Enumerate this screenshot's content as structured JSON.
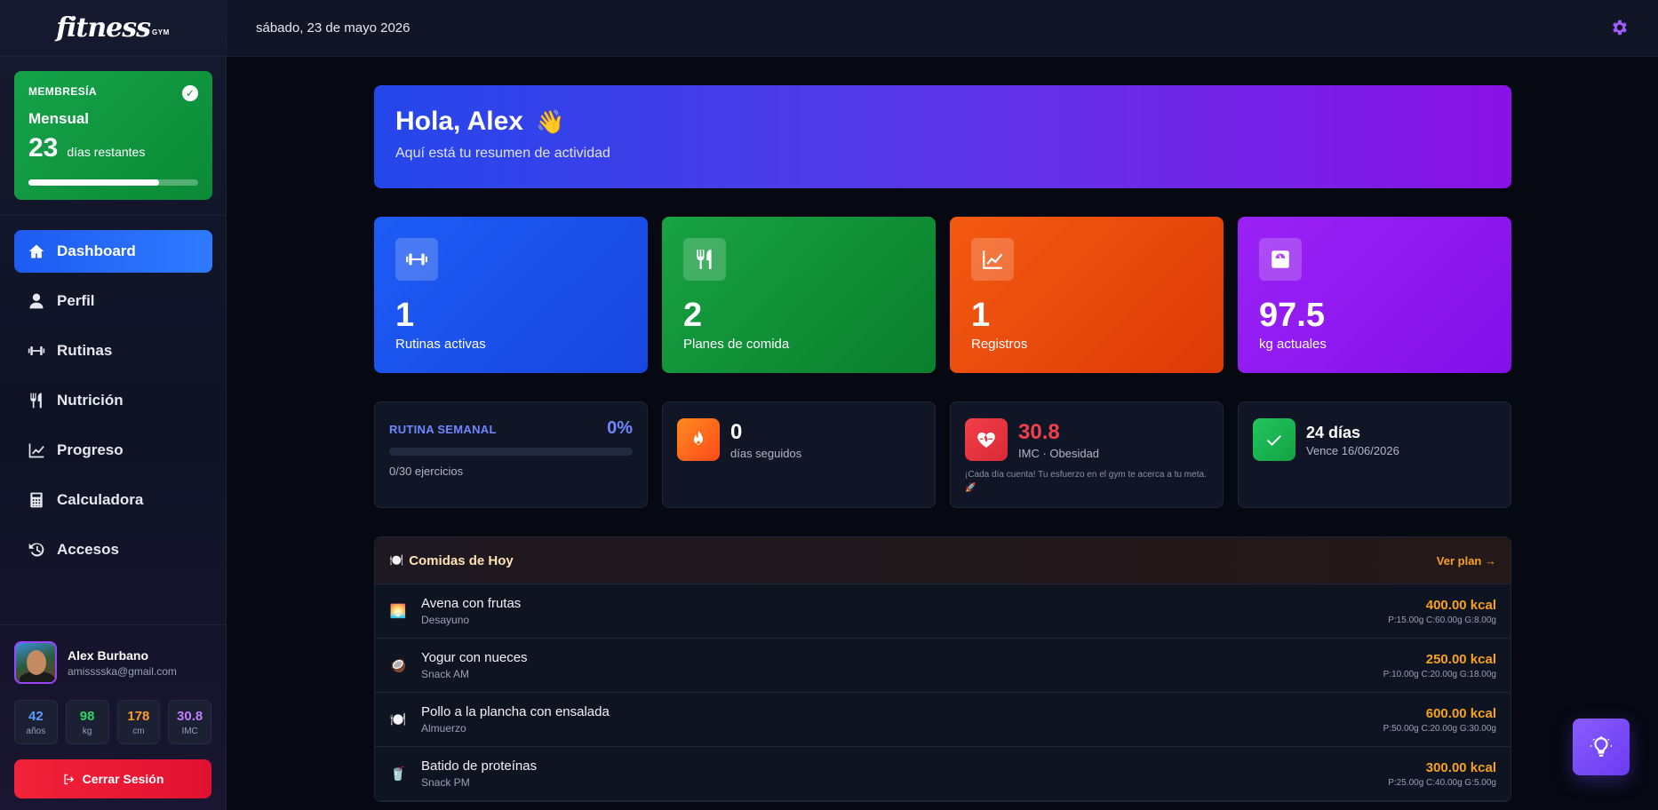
{
  "brand": {
    "logo_text": "fitness",
    "logo_sub": "GYM"
  },
  "header": {
    "date": "sábado, 23 de mayo 2026"
  },
  "membership": {
    "label": "MEMBRESÍA",
    "plan": "Mensual",
    "days": "23",
    "days_label": "días restantes",
    "progress_fraction": 0.77
  },
  "nav": {
    "items": [
      {
        "label": "Dashboard",
        "icon": "home-icon"
      },
      {
        "label": "Perfil",
        "icon": "user-icon"
      },
      {
        "label": "Rutinas",
        "icon": "dumbbell-icon"
      },
      {
        "label": "Nutrición",
        "icon": "utensils-icon"
      },
      {
        "label": "Progreso",
        "icon": "chart-line-icon"
      },
      {
        "label": "Calculadora",
        "icon": "calculator-icon"
      },
      {
        "label": "Accesos",
        "icon": "history-icon"
      }
    ],
    "active": "Dashboard"
  },
  "user": {
    "name": "Alex Burbano",
    "email": "amisssska@gmail.com",
    "stats": [
      {
        "value": "42",
        "label": "años",
        "color": "#5b9bff"
      },
      {
        "value": "98",
        "label": "kg",
        "color": "#2dd466"
      },
      {
        "value": "178",
        "label": "cm",
        "color": "#ff9a2a"
      },
      {
        "value": "30.8",
        "label": "IMC",
        "color": "#c27cff"
      }
    ],
    "logout_label": "Cerrar Sesión"
  },
  "hero": {
    "title": "Hola, Alex",
    "emoji": "👋",
    "subtitle": "Aquí está tu resumen de actividad"
  },
  "cards": [
    {
      "value": "1",
      "label": "Rutinas activas",
      "icon": "dumbbell-icon",
      "color": "#1d5cf5"
    },
    {
      "value": "2",
      "label": "Planes de comida",
      "icon": "utensils-icon",
      "color": "#18a343"
    },
    {
      "value": "1",
      "label": "Registros",
      "icon": "chart-line-icon",
      "color": "#f45a12"
    },
    {
      "value": "97.5",
      "label": "kg actuales",
      "icon": "scale-icon",
      "color": "#9a22f5"
    }
  ],
  "weekly": {
    "label": "RUTINA SEMANAL",
    "percent": "0%",
    "progress_fraction": 0,
    "sub": "0/30 ejercicios"
  },
  "streak": {
    "value": "0",
    "label": "días seguidos"
  },
  "bmi": {
    "value": "30.8",
    "label": "IMC · Obesidad",
    "note": "¡Cada día cuenta! Tu esfuerzo en el gym te acerca a tu meta. 🚀"
  },
  "expiry": {
    "value": "24 días",
    "label": "Vence 16/06/2026"
  },
  "meals": {
    "title": "Comidas de Hoy",
    "title_emoji": "🍽️",
    "link": "Ver plan →",
    "items": [
      {
        "emoji": "🌅",
        "name": "Avena con frutas",
        "type": "Desayuno",
        "kcal": "400.00 kcal",
        "macros": "P:15.00g C:60.00g G:8.00g"
      },
      {
        "emoji": "🥥",
        "name": "Yogur con nueces",
        "type": "Snack AM",
        "kcal": "250.00 kcal",
        "macros": "P:10.00g C:20.00g G:18.00g"
      },
      {
        "emoji": "🍽️",
        "name": "Pollo a la plancha con ensalada",
        "type": "Almuerzo",
        "kcal": "600.00 kcal",
        "macros": "P:50.00g C:20.00g G:30.00g"
      },
      {
        "emoji": "🥤",
        "name": "Batido de proteínas",
        "type": "Snack PM",
        "kcal": "300.00 kcal",
        "macros": "P:25.00g C:40.00g G:5.00g"
      }
    ]
  }
}
